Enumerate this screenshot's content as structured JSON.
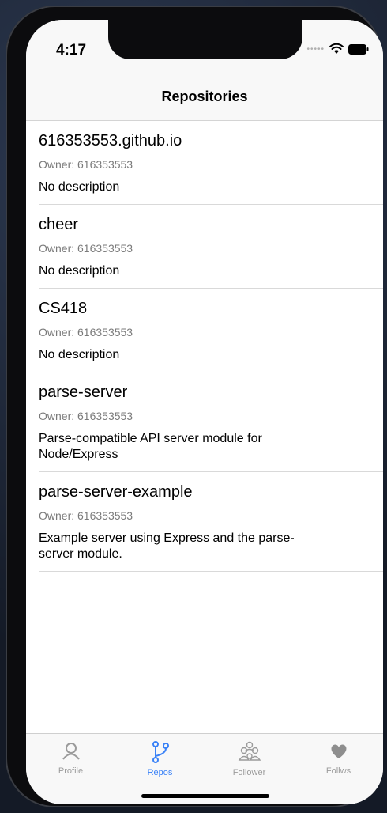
{
  "status_bar": {
    "time": "4:17",
    "signal_icon": "cellular-dots-icon",
    "wifi_icon": "wifi-icon",
    "battery_icon": "battery-icon"
  },
  "nav": {
    "title": "Repositories"
  },
  "repos": [
    {
      "name": "616353553.github.io",
      "owner": "Owner: 616353553",
      "description": "No description"
    },
    {
      "name": "cheer",
      "owner": "Owner: 616353553",
      "description": "No description"
    },
    {
      "name": "CS418",
      "owner": "Owner: 616353553",
      "description": "No description"
    },
    {
      "name": "parse-server",
      "owner": "Owner: 616353553",
      "description": "Parse-compatible API server module for Node/Express"
    },
    {
      "name": "parse-server-example",
      "owner": "Owner: 616353553",
      "description": "Example server using Express and the parse-server module."
    }
  ],
  "tabs": [
    {
      "label": "Profile",
      "icon": "person-icon",
      "active": false
    },
    {
      "label": "Repos",
      "icon": "branch-icon",
      "active": true
    },
    {
      "label": "Follower",
      "icon": "group-icon",
      "active": false
    },
    {
      "label": "Follws",
      "icon": "heart-icon",
      "active": false
    }
  ],
  "colors": {
    "accent": "#3a82f7",
    "inactive": "#9b9b9b"
  }
}
